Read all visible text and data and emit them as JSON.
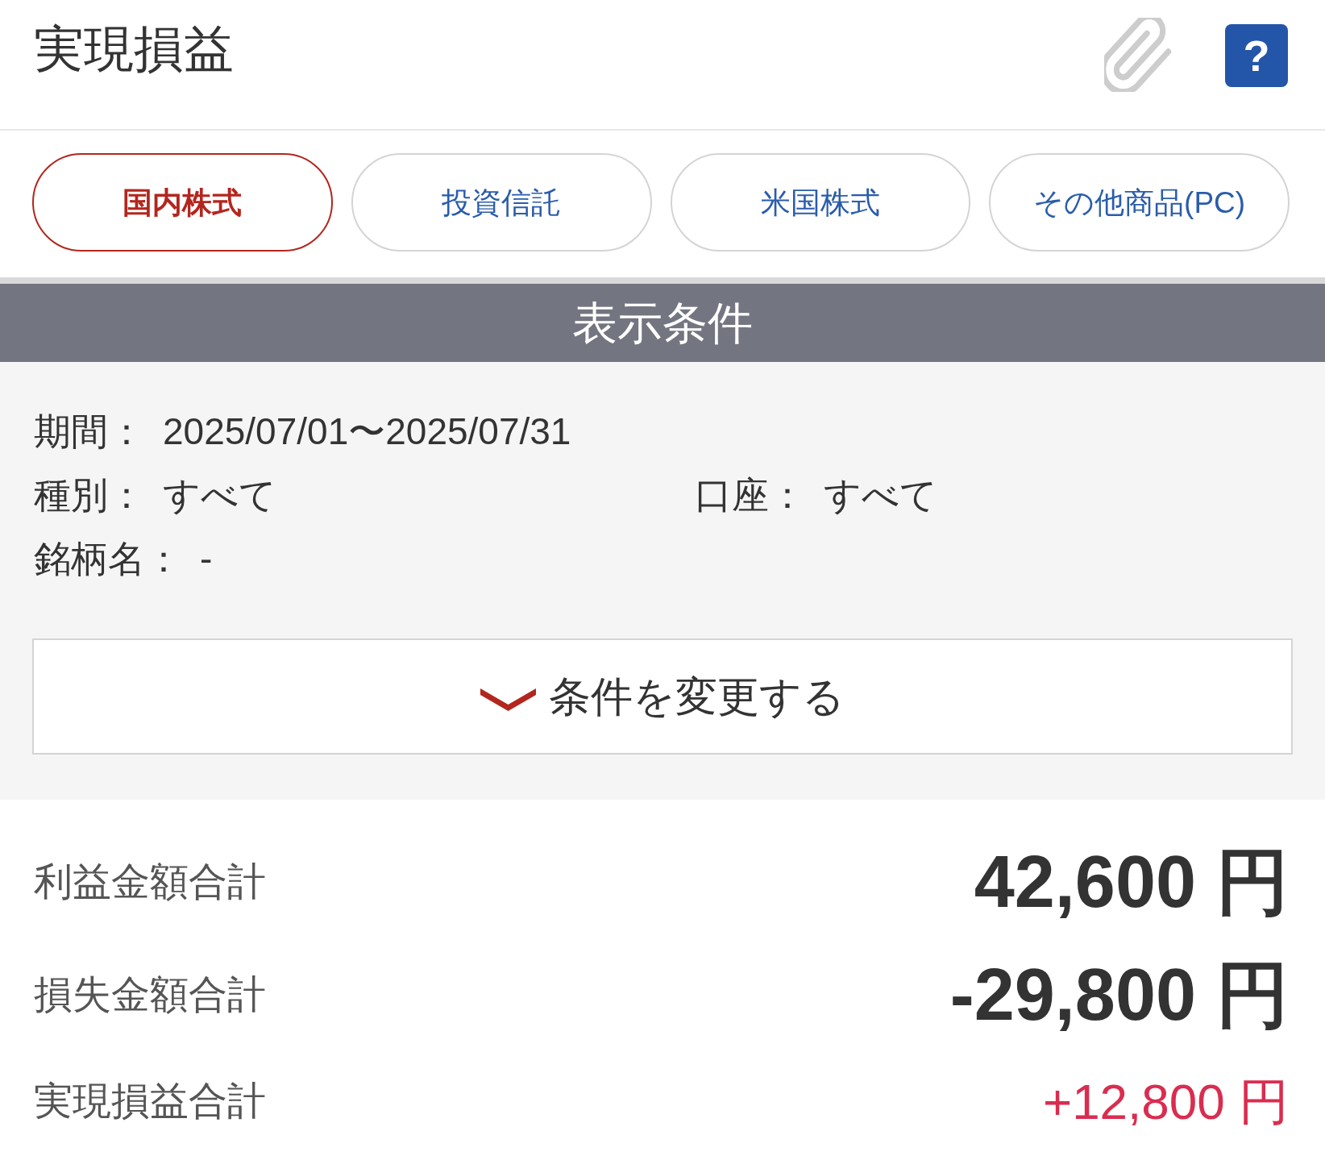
{
  "header": {
    "title": "実現損益",
    "help_button": "?"
  },
  "tabs": [
    {
      "label": "国内株式",
      "selected": true
    },
    {
      "label": "投資信託",
      "selected": false
    },
    {
      "label": "米国株式",
      "selected": false
    },
    {
      "label": "その他商品(PC)",
      "selected": false
    }
  ],
  "conditions": {
    "title": "表示条件",
    "rows": [
      [
        {
          "label": "期間：",
          "value": "2025/07/01〜2025/07/31"
        }
      ],
      [
        {
          "label": "種別：",
          "value": "すべて"
        },
        {
          "label": "口座：",
          "value": "すべて"
        }
      ],
      [
        {
          "label": "銘柄名：",
          "value": "-"
        }
      ]
    ],
    "change_button": "条件を変更する"
  },
  "totals": [
    {
      "kind": "subtotal",
      "label": "利益金額合計",
      "value": "42,600 円"
    },
    {
      "kind": "subtotal",
      "label": "損失金額合計",
      "value": "-29,800 円"
    },
    {
      "kind": "total",
      "label": "実現損益合計",
      "value": "+12,800 円"
    }
  ]
}
